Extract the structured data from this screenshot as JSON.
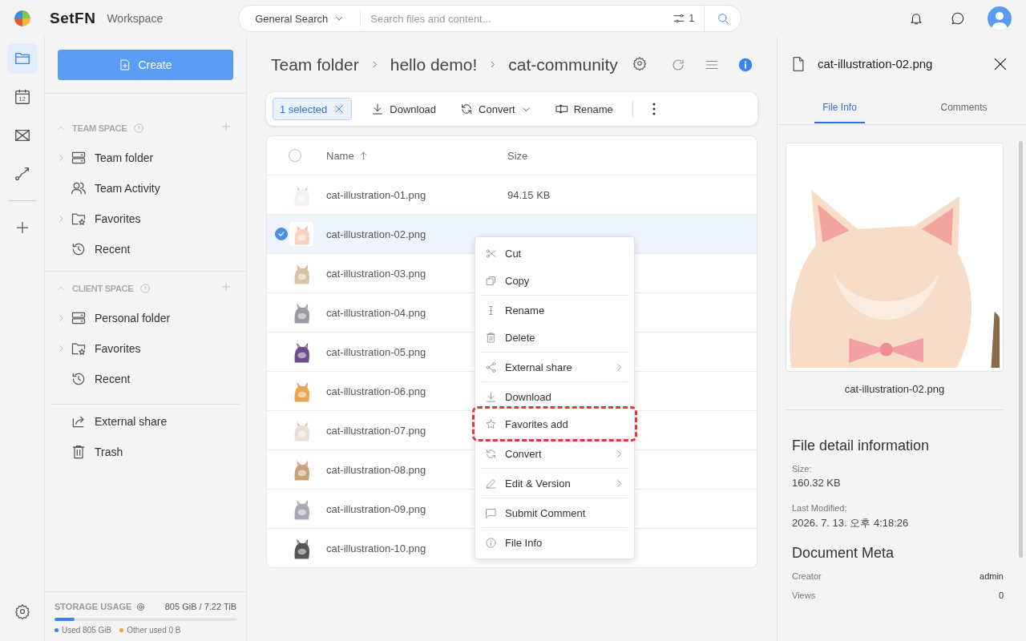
{
  "app": {
    "brand": "SetFN",
    "subtitle": "Workspace"
  },
  "search": {
    "scope": "General Search",
    "placeholder": "Search files and content...",
    "filter_count": "1"
  },
  "rail": [
    {
      "kind": "folder",
      "selected": true
    },
    {
      "kind": "calendar",
      "label": "12",
      "selected": false
    },
    {
      "kind": "mail",
      "selected": false
    },
    {
      "kind": "route",
      "selected": false
    }
  ],
  "create_button": "Create",
  "sections": [
    {
      "title": "TEAM SPACE",
      "expanded": true,
      "items": [
        {
          "label": "Team folder",
          "kind": "server",
          "expandable": true
        },
        {
          "label": "Team Activity",
          "kind": "people",
          "expandable": false
        },
        {
          "label": "Favorites",
          "kind": "starfolder",
          "expandable": true
        },
        {
          "label": "Recent",
          "kind": "history",
          "expandable": false
        }
      ]
    },
    {
      "title": "CLIENT SPACE",
      "expanded": true,
      "items": [
        {
          "label": "Personal folder",
          "kind": "server",
          "expandable": true
        },
        {
          "label": "Favorites",
          "kind": "starfolder",
          "expandable": true
        },
        {
          "label": "Recent",
          "kind": "history",
          "expandable": false
        }
      ]
    }
  ],
  "extra_items": [
    {
      "label": "External share",
      "kind": "share"
    },
    {
      "label": "Trash",
      "kind": "trash"
    }
  ],
  "storage": {
    "title": "STORAGE USAGE",
    "total": "805 GiB / 7.22 TiB",
    "level": 0.11,
    "legend": [
      {
        "label": "Used 805 GiB",
        "color": "#3b82f6"
      },
      {
        "label": "Other used 0 B",
        "color": "#f59e42"
      }
    ]
  },
  "breadcrumbs": [
    "Team folder",
    "hello demo!",
    "cat-community"
  ],
  "toolbar": {
    "selection": "1 selected",
    "actions": [
      {
        "label": "Download",
        "kind": "download",
        "dropdown": false
      },
      {
        "label": "Convert",
        "kind": "convert",
        "dropdown": true
      },
      {
        "label": "Rename",
        "kind": "rename",
        "dropdown": false
      }
    ]
  },
  "table": {
    "columns": [
      "Name",
      "Size"
    ],
    "all_selected": false,
    "rows": [
      {
        "name": "cat-illustration-01.png",
        "size": "94.15 KB",
        "selected": false
      },
      {
        "name": "cat-illustration-02.png",
        "selected": true
      },
      {
        "name": "cat-illustration-03.png",
        "selected": false
      },
      {
        "name": "cat-illustration-04.png",
        "selected": false
      },
      {
        "name": "cat-illustration-05.png",
        "selected": false
      },
      {
        "name": "cat-illustration-06.png",
        "selected": false
      },
      {
        "name": "cat-illustration-07.png",
        "selected": false
      },
      {
        "name": "cat-illustration-08.png",
        "selected": false
      },
      {
        "name": "cat-illustration-09.png",
        "selected": false
      },
      {
        "name": "cat-illustration-10.png",
        "selected": false
      }
    ]
  },
  "context_menu": [
    [
      {
        "label": "Cut",
        "kind": "cut",
        "submenu": false,
        "highlighted": false
      },
      {
        "label": "Copy",
        "kind": "copy",
        "submenu": false,
        "highlighted": false
      }
    ],
    [
      {
        "label": "Rename",
        "kind": "cursor",
        "submenu": false,
        "highlighted": false
      },
      {
        "label": "Delete",
        "kind": "trash",
        "submenu": false,
        "highlighted": false
      }
    ],
    [
      {
        "label": "External share",
        "kind": "sharenodes",
        "submenu": true,
        "highlighted": false
      }
    ],
    [
      {
        "label": "Download",
        "kind": "download",
        "submenu": false,
        "highlighted": false
      },
      {
        "label": "Favorites add",
        "kind": "star",
        "submenu": false,
        "highlighted": true
      }
    ],
    [
      {
        "label": "Convert",
        "kind": "convert",
        "submenu": true,
        "highlighted": false
      }
    ],
    [
      {
        "label": "Edit & Version",
        "kind": "pencil",
        "submenu": true,
        "highlighted": false
      }
    ],
    [
      {
        "label": "Submit Comment",
        "kind": "comment",
        "submenu": false,
        "highlighted": false
      }
    ],
    [
      {
        "label": "File Info",
        "kind": "info",
        "submenu": false,
        "highlighted": false
      }
    ]
  ],
  "panel": {
    "title": "cat-illustration-02.png",
    "tabs": [
      {
        "label": "File Info",
        "selected": true
      },
      {
        "label": "Comments",
        "selected": false
      }
    ],
    "caption": "cat-illustration-02.png",
    "details_heading": "File detail information",
    "fields": [
      {
        "label": "Size:",
        "value": "160.32 KB"
      },
      {
        "label": "Last Modified:",
        "value": "2026. 7. 13. 오후 4:18:26"
      }
    ],
    "meta_heading": "Document Meta",
    "meta": [
      {
        "label": "Creator",
        "value": "admin"
      },
      {
        "label": "Views",
        "value": "0"
      }
    ]
  }
}
